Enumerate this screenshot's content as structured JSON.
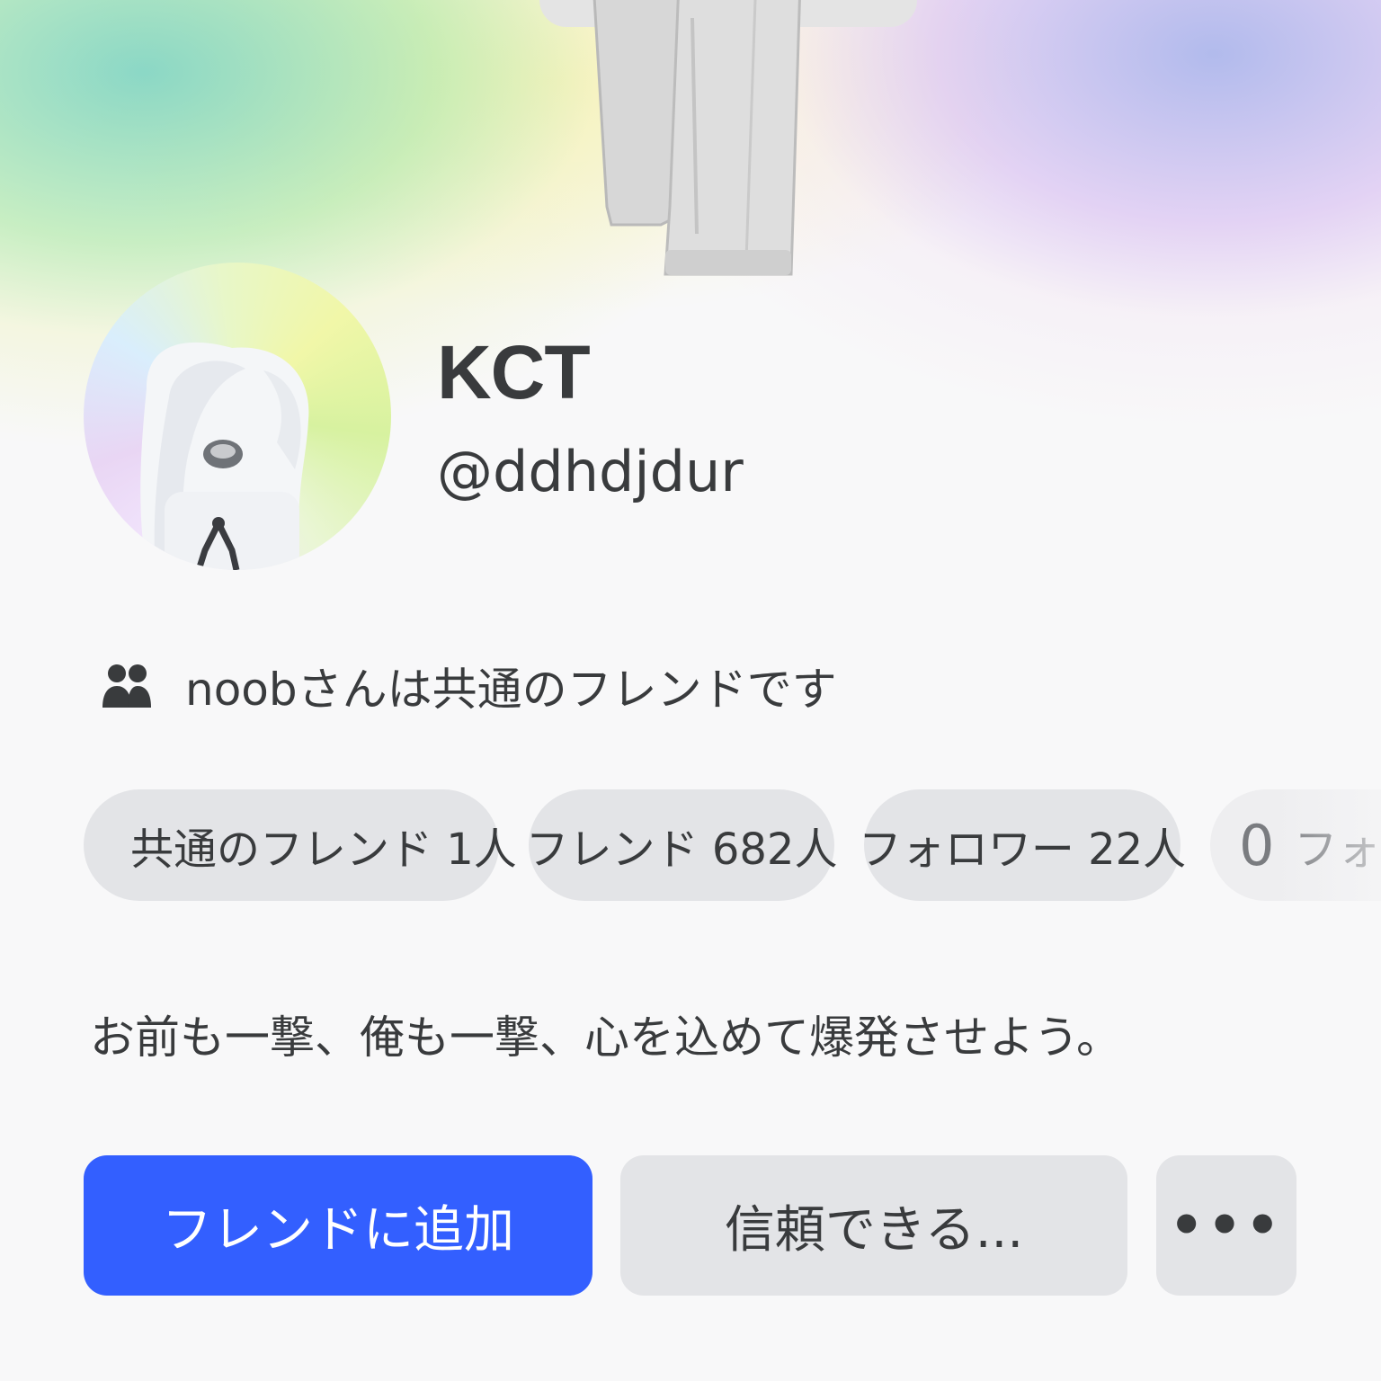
{
  "profile": {
    "display_name": "KCT",
    "username": "@ddhdjdur",
    "mutual_friend_text": "noobさんは共通のフレンドです",
    "bio": "お前も一撃、俺も一撃、心を込めて爆発させよう。"
  },
  "stats": {
    "mutual_label": "共通のフレンド 1人",
    "friends_label": "フレンド 682人",
    "followers_label": "フォロワー 22人",
    "following_count": "0",
    "following_label": "フォロ"
  },
  "actions": {
    "add_friend_label": "フレンドに追加",
    "trust_label": "信頼できる...",
    "more_label": "•••"
  },
  "colors": {
    "accent": "#335fff",
    "pill_bg": "#e3e4e7",
    "text": "#393b3d",
    "page_bg": "#f8f8f9"
  },
  "icons": {
    "mutual_friends": "friends-icon",
    "mutual_avatar": "mini-avatar",
    "more": "more-icon"
  }
}
